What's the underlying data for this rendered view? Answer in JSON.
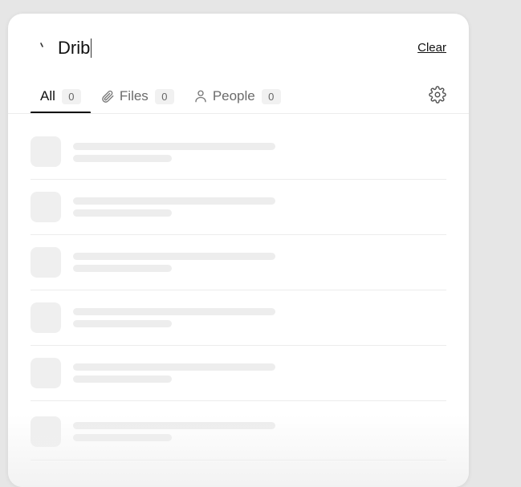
{
  "search": {
    "query": "Drib",
    "clear_label": "Clear"
  },
  "tabs": [
    {
      "label": "All",
      "count": "0",
      "icon": "none",
      "active": true
    },
    {
      "label": "Files",
      "count": "0",
      "icon": "paperclip-icon",
      "active": false
    },
    {
      "label": "People",
      "count": "0",
      "icon": "person-icon",
      "active": false
    }
  ],
  "settings_icon": "gear-icon",
  "results": {
    "state": "loading",
    "skeleton_rows": 6
  }
}
